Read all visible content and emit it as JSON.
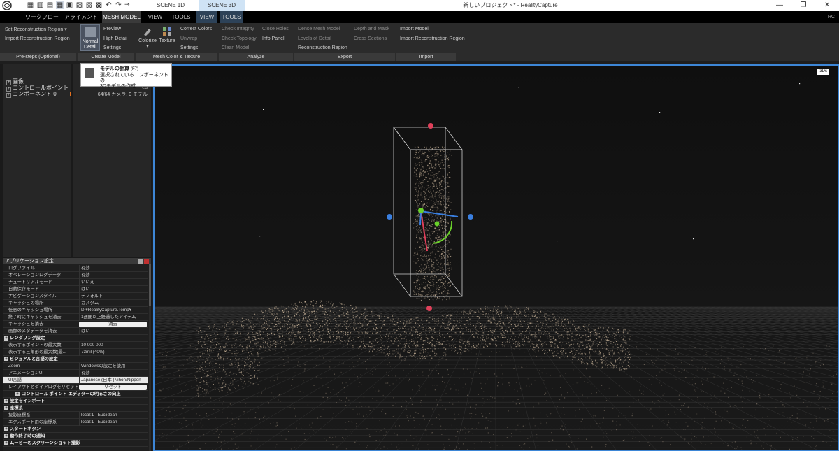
{
  "window": {
    "title": "新しいプロジェクト* - RealityCapture"
  },
  "scene_tabs": [
    "SCENE 1D",
    "SCENE 3D"
  ],
  "window_buttons": [
    "—",
    "❐",
    "✕"
  ],
  "menu": {
    "items": [
      "ワークフロー",
      "アライメント",
      "MESH MODEL",
      "VIEW",
      "TOOLS",
      "VIEW",
      "TOOLS"
    ],
    "user": "RC"
  },
  "ribbon": {
    "prestep": {
      "items": [
        "Set Reconstruction Region",
        "Import Reconstruction Region"
      ],
      "label": "Pre-steps (Optional)",
      "caret": "▾"
    },
    "create": {
      "big": "Normal Detail",
      "items": [
        "Preview",
        "High Detail",
        "Settings"
      ],
      "label": "Create Model"
    },
    "color": {
      "colorize": "Colorize",
      "texture": "Texture",
      "caret": "▾",
      "items": [
        "Correct Colors",
        "Unwrap",
        "Settings"
      ],
      "label": "Mesh Color & Texture"
    },
    "analyze": {
      "col1": [
        "Check Integrity",
        "Check Topology",
        "Clean Model"
      ],
      "col2": [
        "Close Holes",
        "Info Panel"
      ],
      "label": "Analyze"
    },
    "export": {
      "col1": [
        "Dense Mesh Model",
        "Levels of Detail",
        "Reconstruction Region"
      ],
      "col2": [
        "Depth and Mask",
        "Cross Sections"
      ],
      "label": "Export"
    },
    "import": {
      "items": [
        "Import Model",
        "Import Reconstruction Region"
      ],
      "label": "Import"
    }
  },
  "tooltip": {
    "title": "モデルの計算",
    "shortcut": "(F7)",
    "line1": "選択されているコンポーネントの",
    "line2": "3Dモデルの作成"
  },
  "tree": {
    "items": [
      "画像",
      "コントロールポイント",
      "コンポーネント 0"
    ],
    "expander": "+"
  },
  "info": {
    "partial": "ed",
    "line": "64/64 カメラ, 0 モデル"
  },
  "settings": {
    "title": "アプリケーション設定",
    "rows": [
      {
        "k": "ログファイル",
        "v": "有効"
      },
      {
        "k": "オペレーションログデータ",
        "v": "有効"
      },
      {
        "k": "チュートリアルモード",
        "v": "いいえ"
      },
      {
        "k": "自動保存モード",
        "v": "はい"
      },
      {
        "k": "ナビゲーションスタイル",
        "v": "デフォルト"
      },
      {
        "k": "キャッシュの場所",
        "v": "カスタム"
      },
      {
        "k": "任意のキャッシュ場所",
        "v": "D:¥RealityCapture.Temp¥"
      },
      {
        "k": "終了時にキャッシュを消去",
        "v": "1週間以上経過したアイテム"
      },
      {
        "k": "キャッシュを消去",
        "btn": "消去"
      },
      {
        "k": "画像のメタデータを消去",
        "v": "はい"
      },
      {
        "sec": "レンダリング設定"
      },
      {
        "k": "表示するポイントの最大数",
        "v": "10 000 000"
      },
      {
        "k": "表示する三角形の最大数(最...",
        "v": "73mil (40%)"
      },
      {
        "sec": "ビジュアルと言語の設定"
      },
      {
        "k": "Zoom",
        "v": "Windowsの設定を使用"
      },
      {
        "k": "アニメーションUI",
        "v": "有効"
      },
      {
        "k": "UI言語",
        "v": "Japanese (日本 (Nihon/Nippon",
        "hl": true
      },
      {
        "k": "レイアウトとダイアログをリセット",
        "btn": "リセット"
      },
      {
        "sec": "コントロール ポイント エディターの明るさの向上",
        "sub": true
      },
      {
        "sec": "設定をインポート"
      },
      {
        "sec": "座標系"
      },
      {
        "k": "投影座標系",
        "v": "local:1 - Euclidean"
      },
      {
        "k": "エクスポート用の座標系",
        "v": "local:1 - Euclidean"
      },
      {
        "sec": "スタートボタン"
      },
      {
        "sec": "動作終了時の通知"
      },
      {
        "sec": "ムービーのスクリーンショット撮影"
      }
    ]
  },
  "viewport": {
    "badge": "3Ds"
  },
  "colors": {
    "accent": "#3d86d6",
    "gizmo_red": "#e0405a",
    "gizmo_green": "#6ad12a",
    "gizmo_blue": "#3a7fe0",
    "points": "#c9b49a"
  }
}
